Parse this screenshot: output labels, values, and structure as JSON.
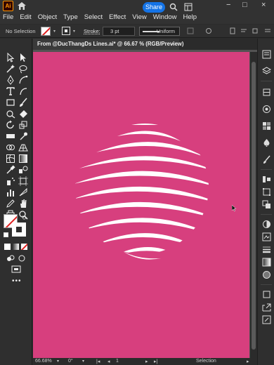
{
  "app": {
    "logo_text": "Ai",
    "share_label": "Share",
    "menus": [
      "File",
      "Edit",
      "Object",
      "Type",
      "Select",
      "Effect",
      "View",
      "Window",
      "Help"
    ]
  },
  "control_bar": {
    "selection_label": "No Selection",
    "stroke_label": "Stroke:",
    "stroke_value": "3 pt",
    "profile_label": "Uniform"
  },
  "document": {
    "tab_title": "From @DucThangDs Lines.ai* @ 66.67 % (RGB/Preview)",
    "close_glyph": "×",
    "artboard_color": "#d73f7e"
  },
  "status_bar": {
    "zoom": "66.68%",
    "rotation": "0°",
    "artboard_number": "1",
    "tool_label": "Selection"
  },
  "colors": {
    "accent": "#1473e6",
    "logo": "#ff9a00",
    "artboard": "#d73f7e"
  }
}
